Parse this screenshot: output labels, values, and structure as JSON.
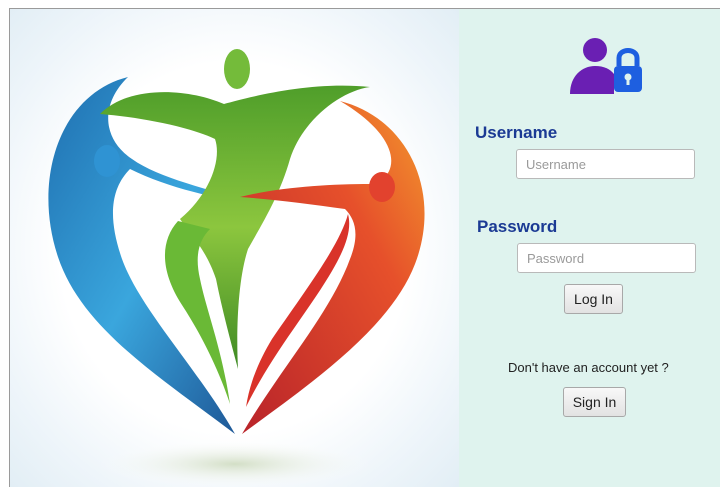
{
  "login": {
    "username_label": "Username",
    "username_placeholder": "Username",
    "username_value": "",
    "password_label": "Password",
    "password_placeholder": "Password",
    "password_value": "",
    "login_button": "Log In",
    "signup_prompt": "Don't have an account yet ?",
    "signin_button": "Sign In"
  },
  "icons": {
    "header": "user-lock-icon",
    "logo": "heart-family-logo"
  },
  "colors": {
    "panel_bg": "#dff3ee",
    "label_blue": "#1b3a94",
    "icon_purple": "#6a1fb3",
    "icon_blue": "#1e5fe0",
    "logo_blue": "#2a8fcf",
    "logo_green": "#5cad2e",
    "logo_red": "#e0342a"
  }
}
